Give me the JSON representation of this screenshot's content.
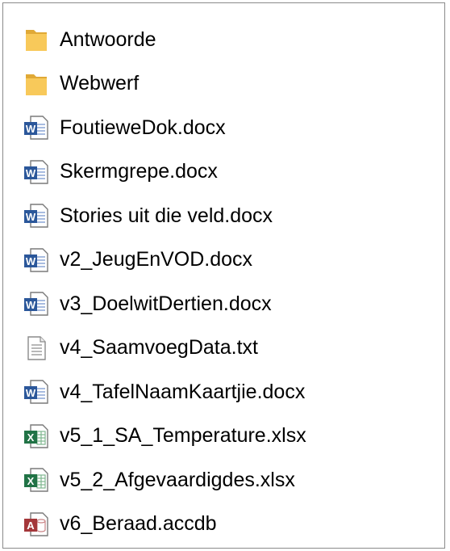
{
  "explorer": {
    "items": [
      {
        "name": "Antwoorde",
        "type": "folder",
        "icon": "folder-icon"
      },
      {
        "name": "Webwerf",
        "type": "folder",
        "icon": "folder-icon"
      },
      {
        "name": "FoutieweDok.docx",
        "type": "word",
        "icon": "word-document-icon"
      },
      {
        "name": "Skermgrepe.docx",
        "type": "word",
        "icon": "word-document-icon"
      },
      {
        "name": "Stories uit die veld.docx",
        "type": "word",
        "icon": "word-document-icon"
      },
      {
        "name": "v2_JeugEnVOD.docx",
        "type": "word",
        "icon": "word-document-icon"
      },
      {
        "name": "v3_DoelwitDertien.docx",
        "type": "word",
        "icon": "word-document-icon"
      },
      {
        "name": "v4_SaamvoegData.txt",
        "type": "text",
        "icon": "text-document-icon"
      },
      {
        "name": "v4_TafelNaamKaartjie.docx",
        "type": "word",
        "icon": "word-document-icon"
      },
      {
        "name": "v5_1_SA_Temperature.xlsx",
        "type": "excel",
        "icon": "excel-document-icon"
      },
      {
        "name": "v5_2_Afgevaardigdes.xlsx",
        "type": "excel",
        "icon": "excel-document-icon"
      },
      {
        "name": "v6_Beraad.accdb",
        "type": "access",
        "icon": "access-database-icon"
      }
    ]
  },
  "colors": {
    "folder": "#F8C95A",
    "folder_dark": "#E0A936",
    "word": "#2B579A",
    "excel": "#217346",
    "access": "#A4373A",
    "page_border": "#8A8A8A"
  }
}
